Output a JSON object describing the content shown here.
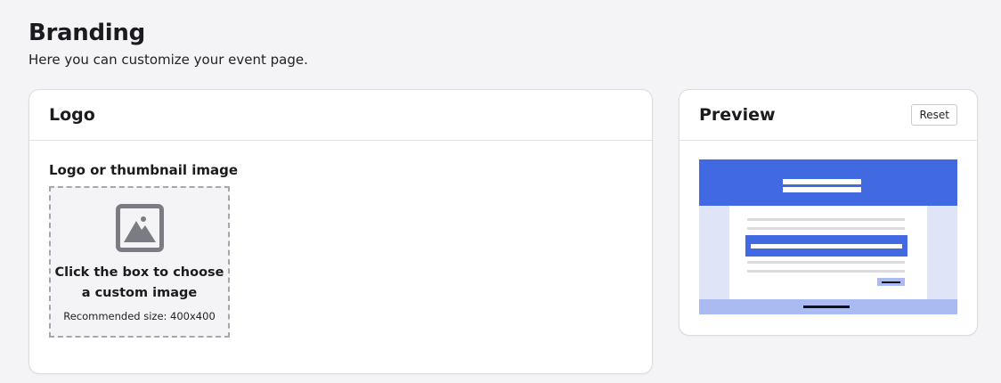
{
  "page": {
    "title": "Branding",
    "subtitle": "Here you can customize your event page."
  },
  "logo_card": {
    "title": "Logo",
    "field_label": "Logo or thumbnail image",
    "dropzone": {
      "icon": "image-icon",
      "prompt": "Click the box to choose a custom image",
      "hint": "Recommended size: 400x400"
    }
  },
  "preview_card": {
    "title": "Preview",
    "reset_label": "Reset"
  },
  "colors": {
    "accent": "#4169e1",
    "accent_light": "#a9bbf0",
    "preview_background": "#dfe5f7",
    "page_background": "#f4f4f6"
  }
}
